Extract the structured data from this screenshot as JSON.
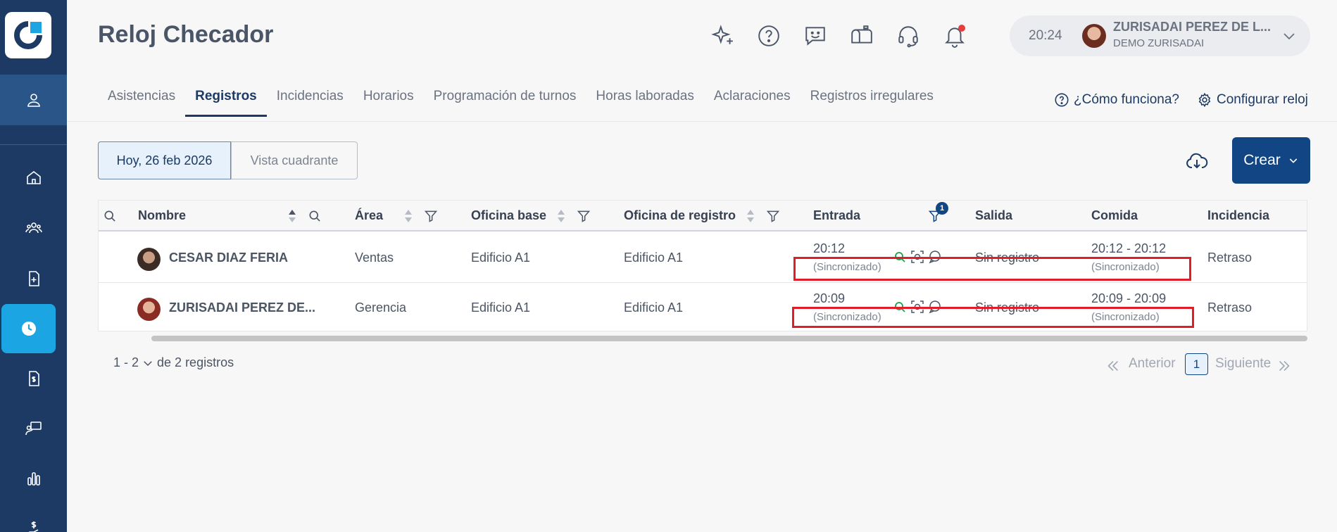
{
  "app": {
    "title": "Reloj Checador"
  },
  "user": {
    "time": "20:24",
    "name": "ZURISADAI PEREZ DE L...",
    "company": "DEMO ZURISADAI"
  },
  "tabs": [
    {
      "label": "Asistencias",
      "active": false
    },
    {
      "label": "Registros",
      "active": true
    },
    {
      "label": "Incidencias",
      "active": false
    },
    {
      "label": "Horarios",
      "active": false
    },
    {
      "label": "Programación de turnos",
      "active": false
    },
    {
      "label": "Horas laboradas",
      "active": false
    },
    {
      "label": "Aclaraciones",
      "active": false
    },
    {
      "label": "Registros irregulares",
      "active": false
    }
  ],
  "links": {
    "how": "¿Cómo funciona?",
    "config": "Configurar reloj"
  },
  "toolbar": {
    "date_label": "Hoy, 26 feb 2026",
    "view_label": "Vista cuadrante",
    "create_label": "Crear"
  },
  "table": {
    "headers": {
      "name": "Nombre",
      "area": "Área",
      "base": "Oficina base",
      "reg": "Oficina de registro",
      "entrada": "Entrada",
      "salida": "Salida",
      "comida": "Comida",
      "incidencia": "Incidencia"
    },
    "filter_badge": "1",
    "rows": [
      {
        "name": "CESAR DIAZ FERIA",
        "area": "Ventas",
        "base": "Edificio A1",
        "reg": "Edificio A1",
        "entrada": "20:12",
        "entrada_status": "(Sincronizado)",
        "salida": "Sin registro",
        "comida": "20:12 - 20:12",
        "comida_status": "(Sincronizado)",
        "incidencia": "Retraso"
      },
      {
        "name": "ZURISADAI PEREZ DE...",
        "area": "Gerencia",
        "base": "Edificio A1",
        "reg": "Edificio A1",
        "entrada": "20:09",
        "entrada_status": "(Sincronizado)",
        "salida": "Sin registro",
        "comida": "20:09 - 20:09",
        "comida_status": "(Sincronizado)",
        "incidencia": "Retraso"
      }
    ]
  },
  "pagination": {
    "range_start": "1 - 2",
    "range_end": "de 2 registros",
    "prev": "Anterior",
    "page": "1",
    "next": "Siguiente"
  },
  "colors": {
    "sidebar": "#1c3a63",
    "accent": "#1ba6e3",
    "primary": "#124584",
    "highlight": "#e11d2a"
  }
}
